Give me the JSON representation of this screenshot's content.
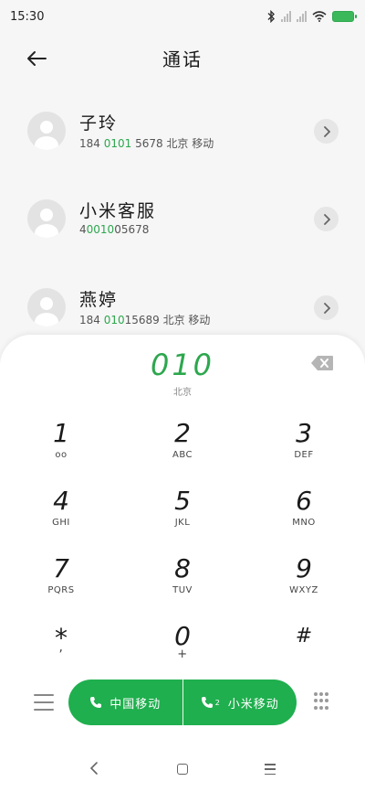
{
  "status": {
    "time": "15:30"
  },
  "header": {
    "title": "通话"
  },
  "contacts": [
    {
      "name": "子玲",
      "num_pre": "184 ",
      "num_hl": "0101",
      "num_post": " 5678 北京 移动"
    },
    {
      "name": "小米客服",
      "num_pre": "4",
      "num_hl": "0010",
      "num_post": "05678"
    },
    {
      "name": "燕婷",
      "num_pre": "184 ",
      "num_hl": "010",
      "num_post": "15689 北京 移动"
    }
  ],
  "dialer": {
    "number": "010",
    "location": "北京",
    "keys": [
      {
        "digit": "1",
        "letters": "ᴏᴏ"
      },
      {
        "digit": "2",
        "letters": "ABC"
      },
      {
        "digit": "3",
        "letters": "DEF"
      },
      {
        "digit": "4",
        "letters": "GHI"
      },
      {
        "digit": "5",
        "letters": "JKL"
      },
      {
        "digit": "6",
        "letters": "MNO"
      },
      {
        "digit": "7",
        "letters": "PQRS"
      },
      {
        "digit": "8",
        "letters": "TUV"
      },
      {
        "digit": "9",
        "letters": "WXYZ"
      },
      {
        "digit": "*",
        "letters": ","
      },
      {
        "digit": "0",
        "letters": "+"
      },
      {
        "digit": "#",
        "letters": ""
      }
    ],
    "call_sim1": "中国移动",
    "call_sim2": "小米移动",
    "sim2_tag": "2"
  },
  "icons": {
    "accent": "#1faf4e"
  }
}
